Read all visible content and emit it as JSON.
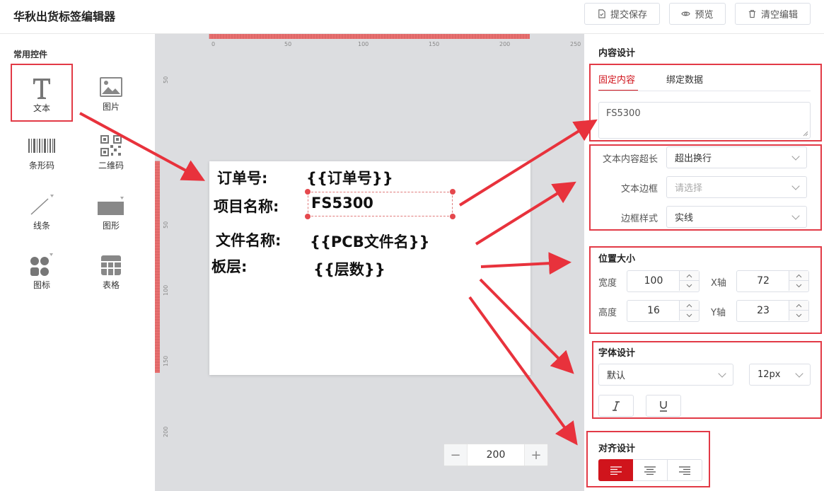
{
  "header": {
    "title": "华秋出货标签编辑器",
    "submit_label": "提交保存",
    "preview_label": "预览",
    "clear_label": "清空编辑"
  },
  "sidebar": {
    "section_title": "常用控件",
    "items": [
      {
        "label": "文本",
        "icon": "text-icon"
      },
      {
        "label": "图片",
        "icon": "image-icon"
      },
      {
        "label": "条形码",
        "icon": "barcode-icon"
      },
      {
        "label": "二维码",
        "icon": "qrcode-icon"
      },
      {
        "label": "线条",
        "icon": "line-icon"
      },
      {
        "label": "图形",
        "icon": "shape-icon"
      },
      {
        "label": "图标",
        "icon": "icon-group-icon"
      },
      {
        "label": "表格",
        "icon": "table-icon"
      }
    ]
  },
  "ruler": {
    "top_ticks": [
      "0",
      "50",
      "100",
      "150",
      "200",
      "250"
    ],
    "left_ticks": [
      "50",
      "50",
      "100",
      "150",
      "200"
    ]
  },
  "label": {
    "line1_key": "订单号:",
    "line1_val": "{{订单号}}",
    "line2_key": "项目名称:",
    "line2_val": "FS5300",
    "line3_key": "文件名称:",
    "line3_val": "{{PCB文件名}}",
    "line4_key": "板层:",
    "line4_val": "{{层数}}"
  },
  "zoom": {
    "value": "200",
    "minus": "−",
    "plus": "+"
  },
  "content_design": {
    "title": "内容设计",
    "tab_fixed": "固定内容",
    "tab_bind": "绑定数据",
    "text_value": "FS5300",
    "overflow_label": "文本内容超长",
    "overflow_value": "超出换行",
    "border_label": "文本边框",
    "border_placeholder": "请选择",
    "border_style_label": "边框样式",
    "border_style_value": "实线"
  },
  "position_size": {
    "title": "位置大小",
    "width_label": "宽度",
    "width_value": "100",
    "x_label": "X轴",
    "x_value": "72",
    "height_label": "高度",
    "height_value": "16",
    "y_label": "Y轴",
    "y_value": "23"
  },
  "font_design": {
    "title": "字体设计",
    "font_value": "默认",
    "size_value": "12px"
  },
  "align_design": {
    "title": "对齐设计",
    "selected": "left"
  },
  "colors": {
    "accent": "#d0141c",
    "highlight": "#e23a46",
    "ruler": "#e87070",
    "canvas_bg": "#dcdde0"
  }
}
